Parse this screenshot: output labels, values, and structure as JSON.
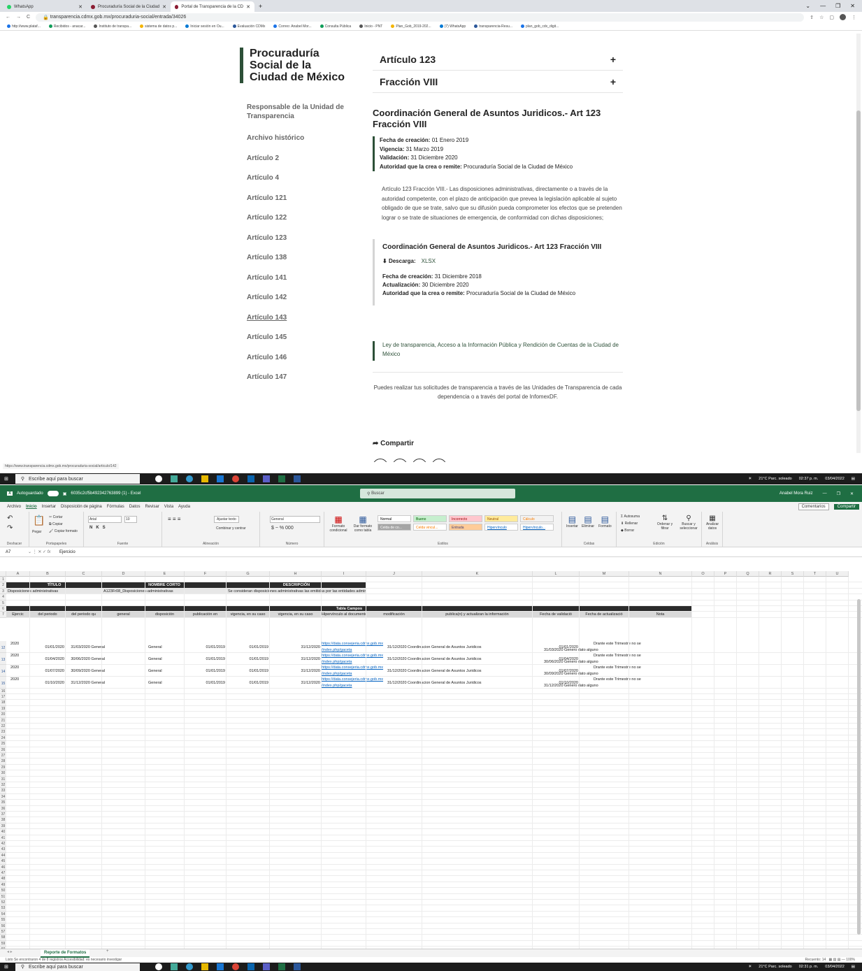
{
  "browser": {
    "tabs": [
      {
        "label": "WhatsApp"
      },
      {
        "label": "Procuraduría Social de la Ciudad"
      },
      {
        "label": "Portal de Transparencia de la CD"
      }
    ],
    "url": "transparencia.cdmx.gob.mx/procuraduria-social/entrada/34026",
    "bookmarks": [
      "http://www.plataf...",
      "Recibidos - anacar...",
      "Instituto de transpa...",
      "sistema de datos p...",
      "Iniciar sesión en Ou...",
      "Evaluación CDMx",
      "Correo: Anabel Mor...",
      "Consulta Pública",
      "Inicio - PNT",
      "Plan_Gob_2019-202...",
      "(7) WhatsApp",
      "transparencia-Resu...",
      "plan_gob_cdx_digit..."
    ],
    "status_url": "https://www.transparencia.cdmx.gob.mx/procuraduria-social/articulo/142"
  },
  "site": {
    "brand": "Procuraduría Social de la Ciudad de México",
    "nav": [
      "Responsable de la Unidad de Transparencia",
      "Archivo histórico",
      "Artículo 2",
      "Artículo 4",
      "Artículo 121",
      "Artículo 122",
      "Artículo 123",
      "Artículo 138",
      "Artículo 141",
      "Artículo 142",
      "Artículo 143",
      "Artículo 145",
      "Artículo 146",
      "Artículo 147"
    ],
    "acc1": "Artículo 123",
    "acc2": "Fracción VIII",
    "plus": "+",
    "title": "Coordinación General de Asuntos Juridicos.- Art 123 Fracción VIII",
    "meta": {
      "k1": "Fecha de creación:",
      "v1": "01 Enero 2019",
      "k2": "Vigencia:",
      "v2": "31 Marzo 2019",
      "k3": "Validación:",
      "v3": "31 Diciembre 2020",
      "k4": "Autoridad que la crea o remite:",
      "v4": "Procuraduría Social de la Ciudad de México"
    },
    "description": "Artículo 123 Fracción VIII.- Las disposiciones administrativas, directamente o a través de la autoridad competente, con el plazo de anticipación que prevea la legislación aplicable al sujeto obligado de que se trate, salvo que su difusión pueda comprometer los efectos que se pretenden lograr o se trate de situaciones de emergencia, de conformidad con dichas disposiciones;",
    "file": {
      "title": "Coordinación General de Asuntos Juridicos.- Art 123 Fracción VIII",
      "dl_label": "Descarga:",
      "dl_format": "XLSX",
      "k1": "Fecha de creación:",
      "v1": "31 Diciembre 2018",
      "k2": "Actualización:",
      "v2": "30 Diciembre 2020",
      "k3": "Autoridad que la crea o remite:",
      "v3": "Procuraduría Social de la Ciudad de México"
    },
    "law": "Ley de transparencia, Acceso a la Información Pública y Rendición de Cuentas de la Ciudad de México",
    "footer": "Puedes realizar tus solicitudes de transparencia a través de las Unidades de Transparencia de cada dependencia o a través del portal de InfomexDF.",
    "share": "Compartir"
  },
  "taskbar": {
    "search": "Escribe aquí para buscar",
    "weather": "21°C Parc. soleado",
    "time": "02:37 p. m.",
    "date": "03/04/2022",
    "time2": "02:31 p. m."
  },
  "excel": {
    "autosave": "Autoguardado",
    "filename": "6035c2cf5b492342763899 (1) - Excel",
    "search": "Buscar",
    "user": "Anabel Mora Ruiz",
    "menu": [
      "Archivo",
      "Inicio",
      "Insertar",
      "Disposición de página",
      "Fórmulas",
      "Datos",
      "Revisar",
      "Vista",
      "Ayuda"
    ],
    "comments": "Comentarios",
    "share": "Compartir",
    "ribbon": {
      "font": "Arial",
      "size": "10",
      "wrap": "Ajustar texto",
      "merge": "Combinar y centrar",
      "format": "General",
      "cond": "Formato condicional",
      "table": "Dar formato como tabla",
      "insert": "Insertar",
      "delete": "Eliminar",
      "fmt": "Formato",
      "autosum": "Autosuma",
      "fill": "Rellenar",
      "clear": "Borrar",
      "sort": "Ordenar y filtrar",
      "find": "Buscar y seleccionar",
      "analyze": "Analizar datos",
      "paste": "Pegar",
      "cut": "Cortar",
      "copy": "Copiar",
      "copyfmt": "Copiar formato",
      "groups": [
        "Deshacer",
        "Portapapeles",
        "Fuente",
        "Alineación",
        "Número",
        "Estilos",
        "Celdas",
        "Edición",
        "Análisis"
      ],
      "styles": [
        {
          "n": "Normal",
          "c": "#ffffff"
        },
        {
          "n": "Bueno",
          "c": "#c6efce"
        },
        {
          "n": "Incorrecto",
          "c": "#ffc7ce"
        },
        {
          "n": "Neutral",
          "c": "#ffeb9c"
        },
        {
          "n": "Cálculo",
          "c": "#f2f2f2"
        },
        {
          "n": "Celda de co...",
          "c": "#a5a5a5"
        },
        {
          "n": "Celda vincul...",
          "c": "#ffffff"
        },
        {
          "n": "Entrada",
          "c": "#ffcc99"
        },
        {
          "n": "Hipervínculo",
          "c": "#ffffff"
        },
        {
          "n": "Hipervínculo...",
          "c": "#ffffff"
        }
      ]
    },
    "namebox": "A7",
    "formula": "Ejercicio",
    "cols": [
      "A",
      "B",
      "C",
      "D",
      "E",
      "F",
      "G",
      "H",
      "I",
      "J",
      "K",
      "L",
      "M",
      "N",
      "O",
      "P",
      "Q",
      "R",
      "S",
      "T",
      "U"
    ],
    "r2": {
      "titulo": "TÍTULO",
      "nombre": "NOMBRE CORTO",
      "descripcion": "DESCRIPCIÓN"
    },
    "r3": {
      "titulo": "Disposiciones administrativas",
      "nombre": "A123Fr08_Disposiciones-administrativas",
      "descripcion": "Se consideran disposiciones administrativas las emitidas por las entidades administrativ"
    },
    "r6": "Tabla Campos",
    "headers": [
      "Ejercic",
      "del periodo",
      "del periodo qu",
      "general",
      "disposición",
      "publicación en",
      "vigencia, en su caso",
      "vigencia, en su caso",
      "Hipervínculo al documento complet",
      "modificación",
      "publica(n) y actualizan la información",
      "Fecha de validació",
      "Fecha de actualizació",
      "Nota"
    ],
    "rows": [
      {
        "a": "2020",
        "b": "01/01/2020",
        "c": "31/03/2020 General",
        "e": "General",
        "f": "01/01/2019",
        "g": "01/01/2019",
        "h": "31/12/2020",
        "i1": "https://data.consejeria.cdmx.gob.mx",
        "i2": "/index.php/gaceta",
        "j": "31/12/2020 Coordinacion General de Asuntos Juridicos",
        "l": "01/01/2020",
        "m": "31/03/2020 Genero dato alguno",
        "n": "Drante este Trimestre no se"
      },
      {
        "a": "2020",
        "b": "01/04/2020",
        "c": "30/06/2020 General",
        "e": "General",
        "f": "01/01/2019",
        "g": "01/01/2019",
        "h": "31/12/2020",
        "i1": "https://data.consejeria.cdmx.gob.mx",
        "i2": "/index.php/gaceta",
        "j": "31/12/2020 Coordinacion General de Asuntos Juridicos",
        "l": "01/04/2020",
        "m": "30/06/2020 Genero dato alguno",
        "n": "Drante este Trimestre no se"
      },
      {
        "a": "2020",
        "b": "01/07/2020",
        "c": "30/09/2020 General",
        "e": "General",
        "f": "01/01/2019",
        "g": "01/01/2019",
        "h": "31/12/2020",
        "i1": "https://data.consejeria.cdmx.gob.mx",
        "i2": "/index.php/gaceta",
        "j": "31/12/2020 Coordinacion General de Asuntos Juridicos",
        "l": "01/07/2020",
        "m": "30/09/2020 Genero dato alguno",
        "n": "Drante este Trimestre no se"
      },
      {
        "a": "2020",
        "b": "01/10/2020",
        "c": "31/12/2020 General",
        "e": "General",
        "f": "01/01/2019",
        "g": "01/01/2019",
        "h": "31/12/2020",
        "i1": "https://data.consejeria.cdmx.gob.mx",
        "i2": "/index.php/gaceta",
        "j": "31/12/2020 Coordinacion General de Asuntos Juridicos",
        "l": "01/10/2020",
        "m": "31/12/2020 Genero dato alguno",
        "n": "Drante este Trimestre no se"
      }
    ],
    "sheet": "Reporte de Formatos",
    "status_left": "Listo   Se encontraron 4 de 8 registros   Accesibilidad: es necesario investigar",
    "recuento": "Recuento: 14",
    "zoom": "100%"
  }
}
